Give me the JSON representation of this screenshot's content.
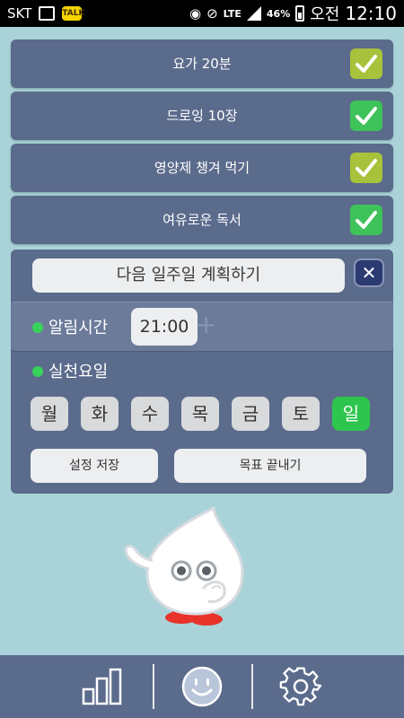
{
  "status_bar": {
    "carrier": "SKT",
    "network": "LTE",
    "battery": "46%",
    "ampm": "오전",
    "time": "12:10",
    "icons": [
      "image-icon",
      "kakaotalk-icon",
      "eye-icon",
      "mute-icon",
      "lte-icon",
      "signal-icon",
      "battery-icon"
    ]
  },
  "goals": [
    {
      "label": "요가 20분",
      "check_color": "#a8c23b"
    },
    {
      "label": "드로잉 10장",
      "check_color": "#3ec25a"
    },
    {
      "label": "영양제 챙겨 먹기",
      "check_color": "#a8c23b"
    },
    {
      "label": "여유로운 독서",
      "check_color": "#3ec25a"
    }
  ],
  "panel": {
    "plan_button": "다음 일주일 계획하기",
    "alarm_label": "알림시간",
    "alarm_time": "21:00",
    "days_label": "실천요일",
    "days": [
      "월",
      "화",
      "수",
      "목",
      "금",
      "토",
      "일"
    ],
    "active_day": "일",
    "save_button": "설정 저장",
    "end_button": "목표 끝내기"
  },
  "bottom_nav": {
    "items": [
      "chart-icon",
      "smiley-icon",
      "gear-icon"
    ]
  },
  "colors": {
    "background": "#a9d3d9",
    "card": "#5b6b8c",
    "accent_green": "#2ec54e",
    "accent_olive": "#a8c23b"
  }
}
